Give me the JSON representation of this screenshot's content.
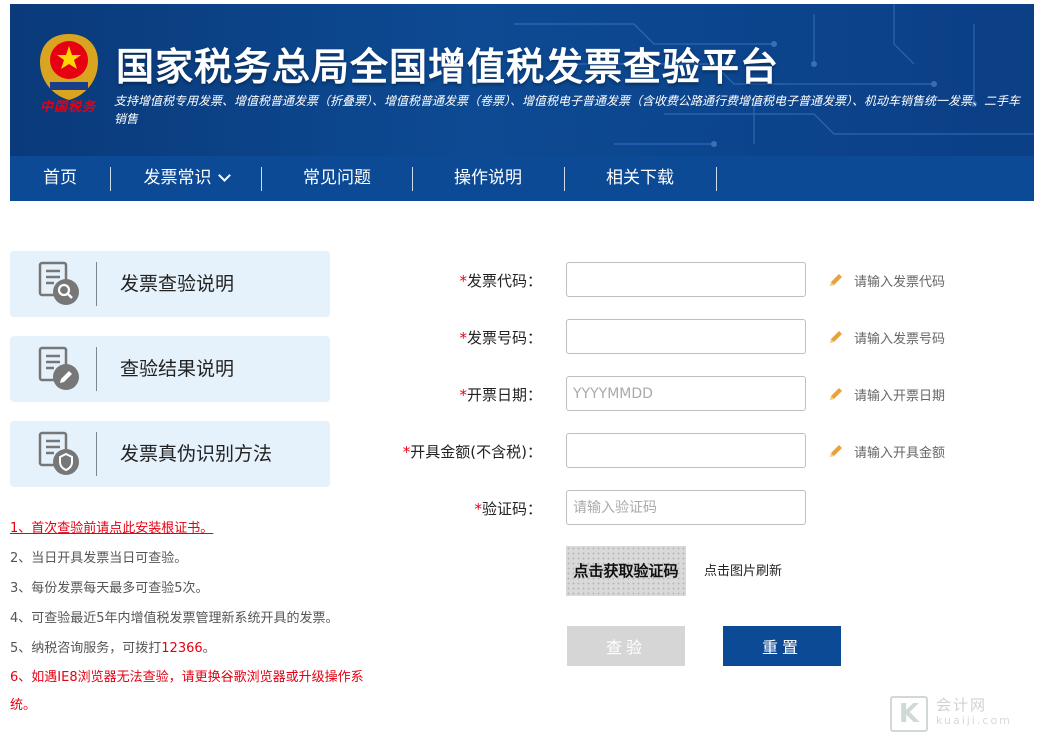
{
  "header": {
    "emblem_text": "中国税务",
    "title": "国家税务总局全国增值税发票查验平台",
    "subtitle": "支持增值税专用发票、增值税普通发票（折叠票）、增值税普通发票（卷票）、增值税电子普通发票（含收费公路通行费增值税电子普通发票）、机动车销售统一发票、二手车销售"
  },
  "nav": {
    "items": [
      "首页",
      "发票常识",
      "常见问题",
      "操作说明",
      "相关下载"
    ]
  },
  "cards": [
    {
      "label": "发票查验说明",
      "icon": "document-search-icon"
    },
    {
      "label": "查验结果说明",
      "icon": "document-edit-icon"
    },
    {
      "label": "发票真伪识别方法",
      "icon": "document-shield-icon"
    }
  ],
  "notes": {
    "n1": "1、首次查验前请点此安装根证书。",
    "n2": "2、当日开具发票当日可查验。",
    "n3": "3、每份发票每天最多可查验5次。",
    "n4": "4、可查验最近5年内增值税发票管理新系统开具的发票。",
    "n5_prefix": "5、纳税咨询服务，可拨打",
    "n5_phone": "12366",
    "n5_suffix": "。",
    "n6": "6、如遇IE8浏览器无法查验，请更换谷歌浏览器或升级操作系统。"
  },
  "form": {
    "required_mark": "*",
    "code_label": "发票代码：",
    "code_hint": "请输入发票代码",
    "number_label": "发票号码：",
    "number_hint": "请输入发票号码",
    "date_label": "开票日期：",
    "date_placeholder": "YYYYMMDD",
    "date_hint": "请输入开票日期",
    "amount_label": "开具金额(不含税)：",
    "amount_hint": "请输入开具金额",
    "captcha_label": "验证码：",
    "captcha_placeholder": "请输入验证码",
    "captcha_image_text": "点击获取验证码",
    "refresh_text": "点击图片刷新",
    "query_button": "查验",
    "reset_button": "重置"
  },
  "watermark": {
    "letter": "K",
    "name": "会计网",
    "domain": "kuaiji.com"
  },
  "colors": {
    "header_blue": "#0c4a96",
    "card_bg": "#e6f2fb",
    "required_red": "#e60012",
    "hint_pencil": "#e8a23a"
  }
}
